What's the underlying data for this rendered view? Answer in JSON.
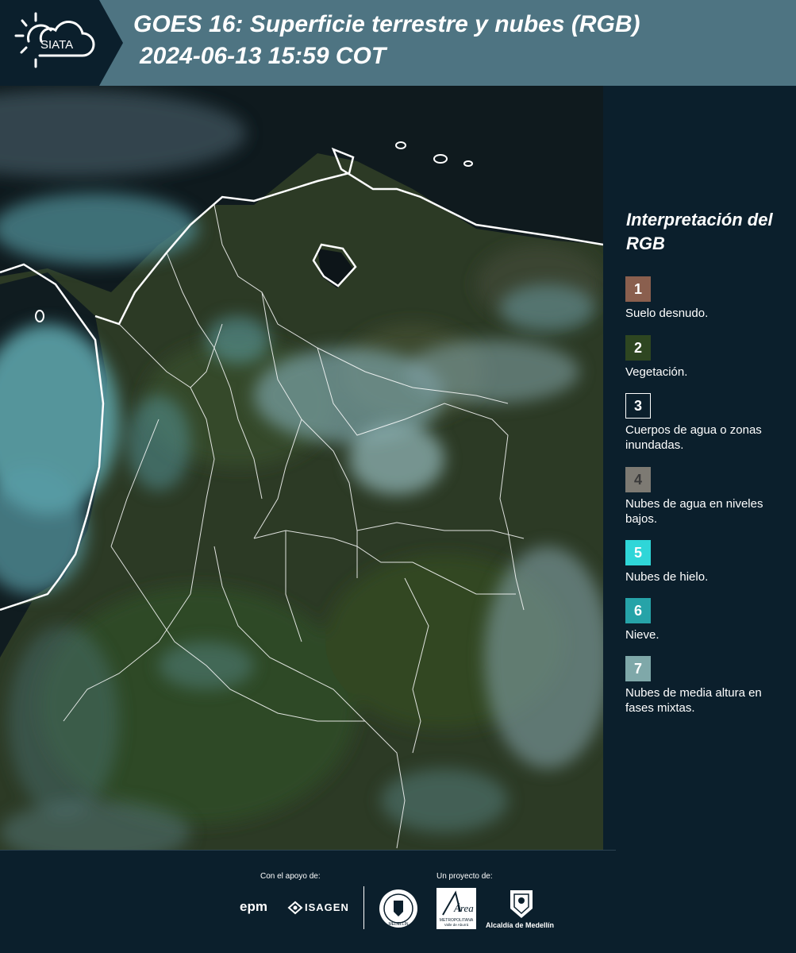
{
  "header": {
    "logo_text": "SIATA",
    "title_line1": "GOES 16: Superficie terrestre y nubes (RGB)",
    "title_line2": "2024-06-13 15:59 COT",
    "background": "#4e7482"
  },
  "legend": {
    "title": "Interpretación del RGB",
    "items": [
      {
        "number": "1",
        "label": "Suelo desnudo.",
        "color": "#8a5f4e"
      },
      {
        "number": "2",
        "label": "Vegetación.",
        "color": "#2e4621"
      },
      {
        "number": "3",
        "label": "Cuerpos de agua o zonas inundadas.",
        "color": "#0b1f2c"
      },
      {
        "number": "4",
        "label": "Nubes de agua en niveles bajos.",
        "color": "#7d7a73"
      },
      {
        "number": "5",
        "label": "Nubes de hielo.",
        "color": "#2fd6d8"
      },
      {
        "number": "6",
        "label": "Nieve.",
        "color": "#26a3a8"
      },
      {
        "number": "7",
        "label": "Nubes de media altura en fases mixtas.",
        "color": "#7fa8a9"
      }
    ]
  },
  "footer": {
    "support_label": "Con el apoyo de:",
    "project_label": "Un proyecto de:",
    "epm": "epm",
    "isagen": "ISAGEN",
    "area_metropolitana": "Área",
    "area_subtitle": "METROPOLITANA",
    "area_subtitle2": "Valle de Aburrá",
    "alcaldia": "Alcaldía de Medellín",
    "medellin_seal": "MEDELLÍN"
  }
}
